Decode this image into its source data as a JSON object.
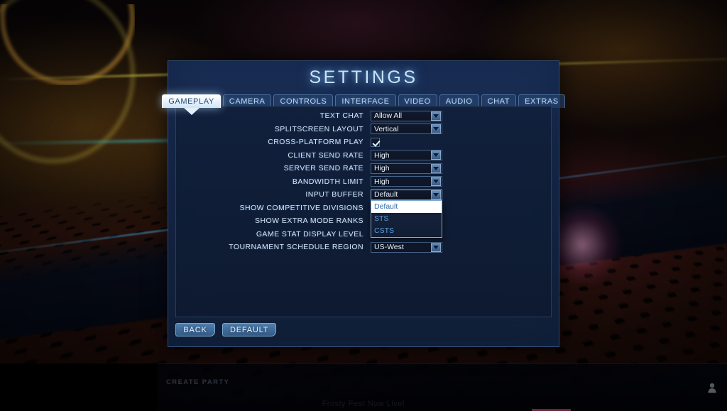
{
  "modal": {
    "title": "SETTINGS",
    "tabs": [
      {
        "label": "GAMEPLAY",
        "active": true
      },
      {
        "label": "CAMERA",
        "active": false
      },
      {
        "label": "CONTROLS",
        "active": false
      },
      {
        "label": "INTERFACE",
        "active": false
      },
      {
        "label": "VIDEO",
        "active": false
      },
      {
        "label": "AUDIO",
        "active": false
      },
      {
        "label": "CHAT",
        "active": false
      },
      {
        "label": "EXTRAS",
        "active": false
      }
    ],
    "rows": [
      {
        "label": "TEXT CHAT",
        "type": "select",
        "value": "Allow All"
      },
      {
        "label": "SPLITSCREEN LAYOUT",
        "type": "select",
        "value": "Vertical"
      },
      {
        "label": "CROSS-PLATFORM PLAY",
        "type": "checkbox",
        "checked": true
      },
      {
        "label": "CLIENT SEND RATE",
        "type": "select",
        "value": "High"
      },
      {
        "label": "SERVER SEND RATE",
        "type": "select",
        "value": "High"
      },
      {
        "label": "BANDWIDTH LIMIT",
        "type": "select",
        "value": "High"
      },
      {
        "label": "INPUT BUFFER",
        "type": "select",
        "value": "Default",
        "open": true,
        "options": [
          {
            "label": "Default",
            "highlight": true
          },
          {
            "label": "STS",
            "highlight": false
          },
          {
            "label": "CSTS",
            "highlight": false
          }
        ]
      },
      {
        "label": "SHOW COMPETITIVE DIVISIONS",
        "type": "hidden-by-dropdown"
      },
      {
        "label": "SHOW EXTRA MODE RANKS",
        "type": "hidden-by-dropdown"
      },
      {
        "label": "GAME STAT DISPLAY LEVEL",
        "type": "hidden-by-dropdown"
      },
      {
        "label": "TOURNAMENT SCHEDULE REGION",
        "type": "select",
        "value": "US-West"
      }
    ],
    "footer": {
      "back_label": "BACK",
      "default_label": "DEFAULT"
    }
  },
  "hud": {
    "create_party": "CREATE PARTY",
    "ticker": "Frosty Fest Now Live!",
    "hint": "",
    "user_icon": "user-icon"
  },
  "colors": {
    "accent_blue": "#5d9fe0",
    "panel_blue": "#17294c",
    "title_glow": "#c9e2f7",
    "highlight_white": "#ffffff"
  }
}
